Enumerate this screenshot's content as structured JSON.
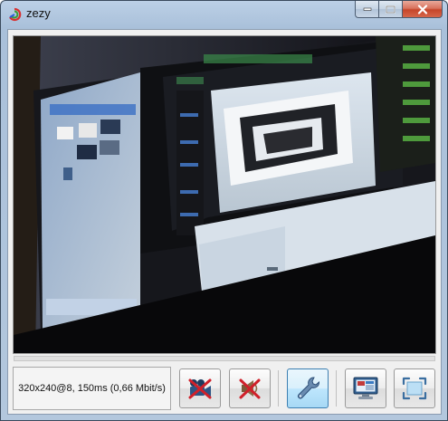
{
  "window": {
    "title": "zezy",
    "app_icon": "rainbow-swirl-icon",
    "caption_buttons": [
      "minimize-icon",
      "maximize-icon",
      "close-icon"
    ]
  },
  "video": {
    "description_icon": "webcam-feed"
  },
  "toolbar": {
    "status_text": "320x240@8, 150ms (0,66 Mbit/s)",
    "buttons": [
      {
        "icon": "camera-off-icon"
      },
      {
        "icon": "speaker-muted-icon"
      },
      {
        "icon": "wrench-settings-icon",
        "active": true
      },
      {
        "icon": "monitor-screen-share-icon"
      },
      {
        "icon": "fullscreen-icon"
      }
    ]
  },
  "colors": {
    "title_gradient": "#b3c7dd",
    "active_button": "#bee6fd",
    "close_button": "#c6452a"
  }
}
